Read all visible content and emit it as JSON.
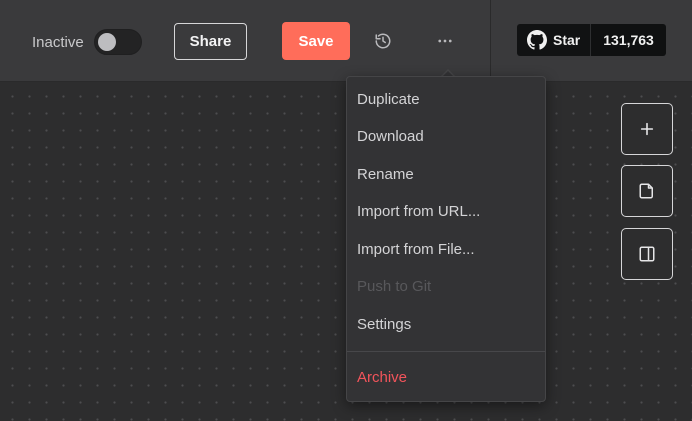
{
  "header": {
    "toggle_label": "Inactive",
    "share_label": "Share",
    "save_label": "Save",
    "history_icon": "history-icon",
    "more_icon": "more-horizontal-icon",
    "github": {
      "icon": "github-icon",
      "star_label": "Star",
      "star_count": "131,763"
    }
  },
  "menu": {
    "items": [
      {
        "label": "Duplicate",
        "state": "enabled"
      },
      {
        "label": "Download",
        "state": "enabled"
      },
      {
        "label": "Rename",
        "state": "enabled"
      },
      {
        "label": "Import from URL...",
        "state": "enabled"
      },
      {
        "label": "Import from File...",
        "state": "enabled"
      },
      {
        "label": "Push to Git",
        "state": "disabled"
      },
      {
        "label": "Settings",
        "state": "enabled"
      },
      {
        "label": "Archive",
        "state": "danger"
      }
    ]
  },
  "side_toolbar": {
    "buttons": [
      {
        "icon": "plus-icon"
      },
      {
        "icon": "sticky-note-icon"
      },
      {
        "icon": "panel-right-icon"
      }
    ]
  },
  "colors": {
    "accent": "#ff6d5a",
    "danger": "#f2545b",
    "background": "#2d2d2e",
    "header": "#3a3a3c"
  }
}
